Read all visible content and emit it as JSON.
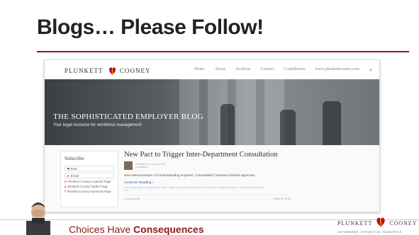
{
  "slide": {
    "title": "Blogs… Please Follow!"
  },
  "site": {
    "logo_left": "PLUNKETT",
    "logo_right": "COONEY",
    "nav": [
      "Home",
      "About",
      "Archives",
      "Contact",
      "Contributors",
      "www.plunkettcooney.com"
    ],
    "search_icon": "search-icon"
  },
  "hero": {
    "title": "THE SOPHISTICATED EMPLOYER BLOG",
    "subtitle": "Your legal resource for workforce management"
  },
  "sidebar": {
    "title": "Subscribe",
    "buttons": [
      "RSS",
      "Email"
    ],
    "links": [
      "Plunkett Cooney LinkedIn Page",
      "Plunkett Cooney Twitter Page",
      "Plunkett Cooney Facebook Page"
    ]
  },
  "post": {
    "title": "New Pact to Trigger Inter-Department Consultation",
    "meta_line1": "POSTED BY CLAUDIA D. ORR",
    "meta_line2": "IN GENERAL",
    "excerpt": "New Memorandum of Understanding imposes \"consultation\" between federal agencies.",
    "read_more": "Continue Reading ›",
    "tags": "TAGS: DEPARTMENT OF LABOR (DOL), EMPLOYMENT LAW, EQUAL EMPLOYMENT OPPORTUNITY COMMISSION (EEOC), LABOR LAW, REGULATORY LAW",
    "comments": "Comments",
    "share": "Share"
  },
  "footer": {
    "tagline_plain": "Choices Have",
    "tagline_bold": "Consequences",
    "logo_left": "PLUNKETT",
    "logo_right": "COONEY",
    "logo_tags": "DETERMINED.   DISTINCTIVE.   FEARLESS.®"
  },
  "colors": {
    "accent": "#8b1a1a",
    "brand_red": "#b5121b",
    "link_blue": "#2a5db0"
  }
}
